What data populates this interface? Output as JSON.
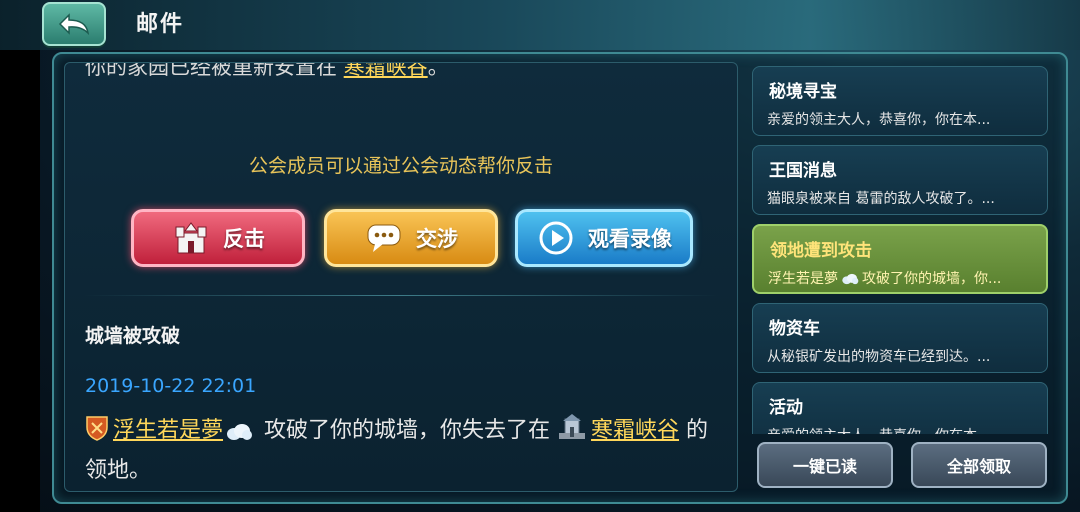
{
  "header": {
    "title": "邮件"
  },
  "detail": {
    "cut_text_prefix": "你的家园已经被重新安置在",
    "cut_text_link": "寒霜峡谷",
    "cut_text_suffix": "。",
    "tip": "公会成员可以通过公会动态帮你反击",
    "buttons": {
      "fight": "反击",
      "negotiate": "交涉",
      "watch": "观看录像"
    },
    "subject": "城墙被攻破",
    "date": "2019-10-22 22:01",
    "attacker": "浮生若是夢",
    "body_mid": "攻破了你的城墙，你失去了在",
    "location": "寒霜峡谷",
    "body_end": "的领地。"
  },
  "mail_list": [
    {
      "title": "秘境寻宝",
      "preview": "亲爱的领主大人，恭喜你，你在本..."
    },
    {
      "title": "王国消息",
      "preview": "猫眼泉被来自 葛雷的敌人攻破了。..."
    },
    {
      "title": "领地遭到攻击",
      "preview": "浮生若是夢",
      "preview_rest": "攻破了你的城墙，你..."
    },
    {
      "title": "物资车",
      "preview": "从秘银矿发出的物资车已经到达。..."
    },
    {
      "title": "活动",
      "preview": "亲爱的领主大人，恭喜你，你在本..."
    }
  ],
  "footer": {
    "read_all": "一键已读",
    "claim_all": "全部领取"
  }
}
